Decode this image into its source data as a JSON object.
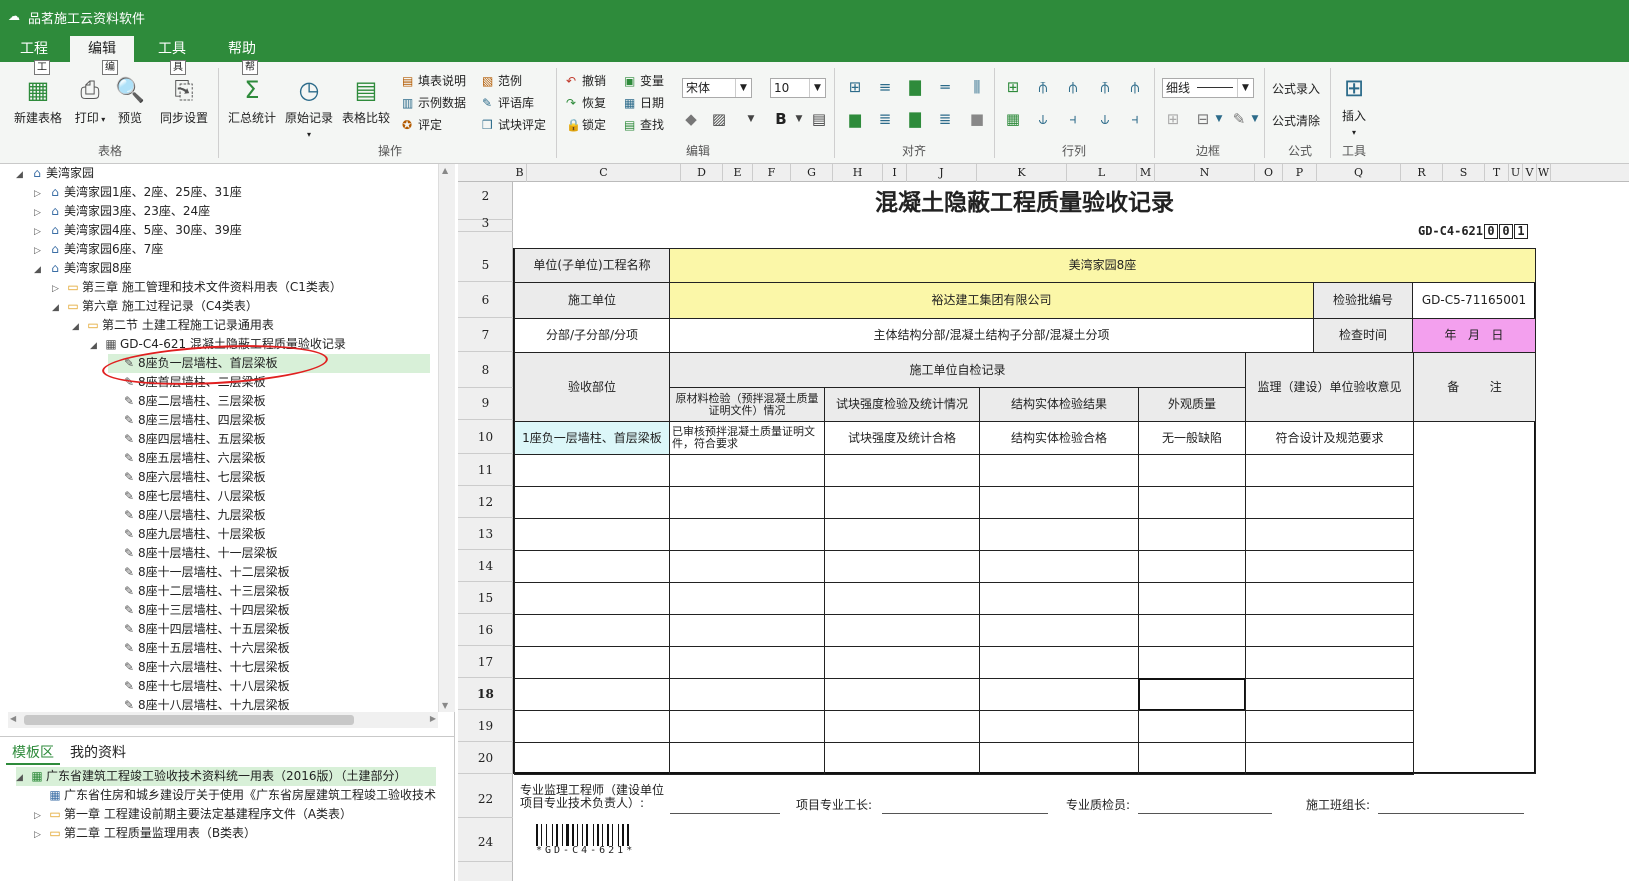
{
  "app": {
    "title": "品茗施工云资料软件"
  },
  "menu": {
    "tabs": [
      "工程",
      "编辑",
      "工具",
      "帮助"
    ]
  },
  "ribbon": {
    "table_group": {
      "label": "表格",
      "new_table": "新建表格",
      "print": "打印",
      "preview": "预览",
      "sync": "同步设置",
      "key_gong": "工",
      "key_bian": "编",
      "key_ju": "具"
    },
    "ops_group": {
      "label": "操作",
      "summary": "汇总统计",
      "raw_record": "原始记录",
      "table_compare": "表格比较",
      "fill_note": "填表说明",
      "example_data": "示例数据",
      "evaluate": "评定",
      "sample": "范例",
      "comment_lib": "评语库",
      "block_eval": "试块评定",
      "key_bang": "帮"
    },
    "edit_group": {
      "label": "编辑",
      "undo": "撤销",
      "redo": "恢复",
      "lock": "锁定",
      "variable": "变量",
      "date": "日期",
      "find": "查找",
      "font": "宋体",
      "size": "10"
    },
    "align_group": {
      "label": "对齐"
    },
    "rowcol_group": {
      "label": "行列"
    },
    "border_group": {
      "label": "边框",
      "line_style": "细线"
    },
    "formula_group": {
      "label": "公式",
      "formula_input": "公式录入",
      "formula_clear": "公式清除"
    },
    "tool_group": {
      "label": "工具",
      "insert": "插入"
    }
  },
  "tree": {
    "items": [
      {
        "label": "美湾家园",
        "icon": "home-icon"
      },
      {
        "label": "美湾家园1座、2座、25座、31座",
        "icon": "home-icon"
      },
      {
        "label": "美湾家园3座、23座、24座",
        "icon": "home-icon"
      },
      {
        "label": "美湾家园4座、5座、30座、39座",
        "icon": "home-icon"
      },
      {
        "label": "美湾家园6座、7座",
        "icon": "home-icon"
      },
      {
        "label": "美湾家园8座",
        "icon": "home-icon"
      },
      {
        "label": "第三章 施工管理和技术文件资料用表（C1类表）",
        "icon": "folder-icon"
      },
      {
        "label": "第六章 施工过程记录（C4类表）",
        "icon": "folder-icon"
      },
      {
        "label": "第二节  土建工程施工记录通用表",
        "icon": "folder-icon"
      },
      {
        "label": "GD-C4-621 混凝土隐蔽工程质量验收记录",
        "icon": "table-icon"
      },
      {
        "label": "8座负一层墙柱、首层梁板",
        "icon": "document-icon"
      },
      {
        "label": "8座首层墙柱、二层梁板",
        "icon": "document-icon"
      },
      {
        "label": "8座二层墙柱、三层梁板",
        "icon": "document-icon"
      },
      {
        "label": "8座三层墙柱、四层梁板",
        "icon": "document-icon"
      },
      {
        "label": "8座四层墙柱、五层梁板",
        "icon": "document-icon"
      },
      {
        "label": "8座五层墙柱、六层梁板",
        "icon": "document-icon"
      },
      {
        "label": "8座六层墙柱、七层梁板",
        "icon": "document-icon"
      },
      {
        "label": "8座七层墙柱、八层梁板",
        "icon": "document-icon"
      },
      {
        "label": "8座八层墙柱、九层梁板",
        "icon": "document-icon"
      },
      {
        "label": "8座九层墙柱、十层梁板",
        "icon": "document-icon"
      },
      {
        "label": "8座十层墙柱、十一层梁板",
        "icon": "document-icon"
      },
      {
        "label": "8座十一层墙柱、十二层梁板",
        "icon": "document-icon"
      },
      {
        "label": "8座十二层墙柱、十三层梁板",
        "icon": "document-icon"
      },
      {
        "label": "8座十三层墙柱、十四层梁板",
        "icon": "document-icon"
      },
      {
        "label": "8座十四层墙柱、十五层梁板",
        "icon": "document-icon"
      },
      {
        "label": "8座十五层墙柱、十六层梁板",
        "icon": "document-icon"
      },
      {
        "label": "8座十六层墙柱、十七层梁板",
        "icon": "document-icon"
      },
      {
        "label": "8座十七层墙柱、十八层梁板",
        "icon": "document-icon"
      },
      {
        "label": "8座十八层墙柱、十九层梁板",
        "icon": "document-icon"
      }
    ]
  },
  "bottom_panel": {
    "tabs": [
      "模板区",
      "我的资料"
    ],
    "items": [
      {
        "label": "广东省建筑工程竣工验收技术资料统一用表（2016版）（土建部分）"
      },
      {
        "label": "广东省住房和城乡建设厅关于使用《广东省房屋建筑工程竣工验收技术"
      },
      {
        "label": "第一章 工程建设前期主要法定基建程序文件（A类表）"
      },
      {
        "label": "第二章 工程质量监理用表（B类表）"
      }
    ]
  },
  "sheet": {
    "columns": [
      "B",
      "C",
      "D",
      "E",
      "F",
      "G",
      "H",
      "I",
      "J",
      "K",
      "L",
      "M",
      "N",
      "O",
      "P",
      "Q",
      "R",
      "S",
      "T",
      "U",
      "V",
      "W"
    ],
    "rows": [
      "2",
      "3",
      "5",
      "6",
      "7",
      "8",
      "9",
      "10",
      "11",
      "12",
      "13",
      "14",
      "15",
      "16",
      "17",
      "18",
      "19",
      "20",
      "22",
      "24"
    ],
    "form": {
      "title": "混凝土隐蔽工程质量验收记录",
      "code": "GD-C4-621",
      "code_boxes": [
        "0",
        "0",
        "1"
      ],
      "unit_project_label": "单位(子单位)工程名称",
      "unit_project_value": "美湾家园8座",
      "construction_unit_label": "施工单位",
      "construction_unit_value": "裕达建工集团有限公司",
      "batch_no_label": "检验批编号",
      "batch_no_value": "GD-C5-71165001",
      "subdivision_label": "分部/子分部/分项",
      "subdivision_value": "主体结构分部/混凝土结构子分部/混凝土分项",
      "check_time_label": "检查时间",
      "check_time_value": "年   月   日",
      "acceptance_part": "验收部位",
      "self_check": "施工单位自检记录",
      "h_raw": "原材料检验（预拌混凝土质量证明文件）情况",
      "h_block": "试块强度检验及统计情况",
      "h_struct": "结构实体检验结果",
      "h_appear": "外观质量",
      "h_supervision": "监理（建设）单位验收意见",
      "h_remark": "备        注",
      "r_part": "1座负一层墙柱、首层梁板",
      "r_raw": "已审核预拌混凝土质量证明文件，符合要求",
      "r_block": "试块强度及统计合格",
      "r_struct": "结构实体检验合格",
      "r_appear": "无一般缺陷",
      "r_supervision": "符合设计及规范要求",
      "sig_engineer": "专业监理工程师（建设单位项目专业技术负责人）:",
      "sig_foreman": "项目专业工长:",
      "sig_inspector": "专业质检员:",
      "sig_team": "施工班组长:",
      "barcode_text": "*GD-C4-621*"
    }
  }
}
